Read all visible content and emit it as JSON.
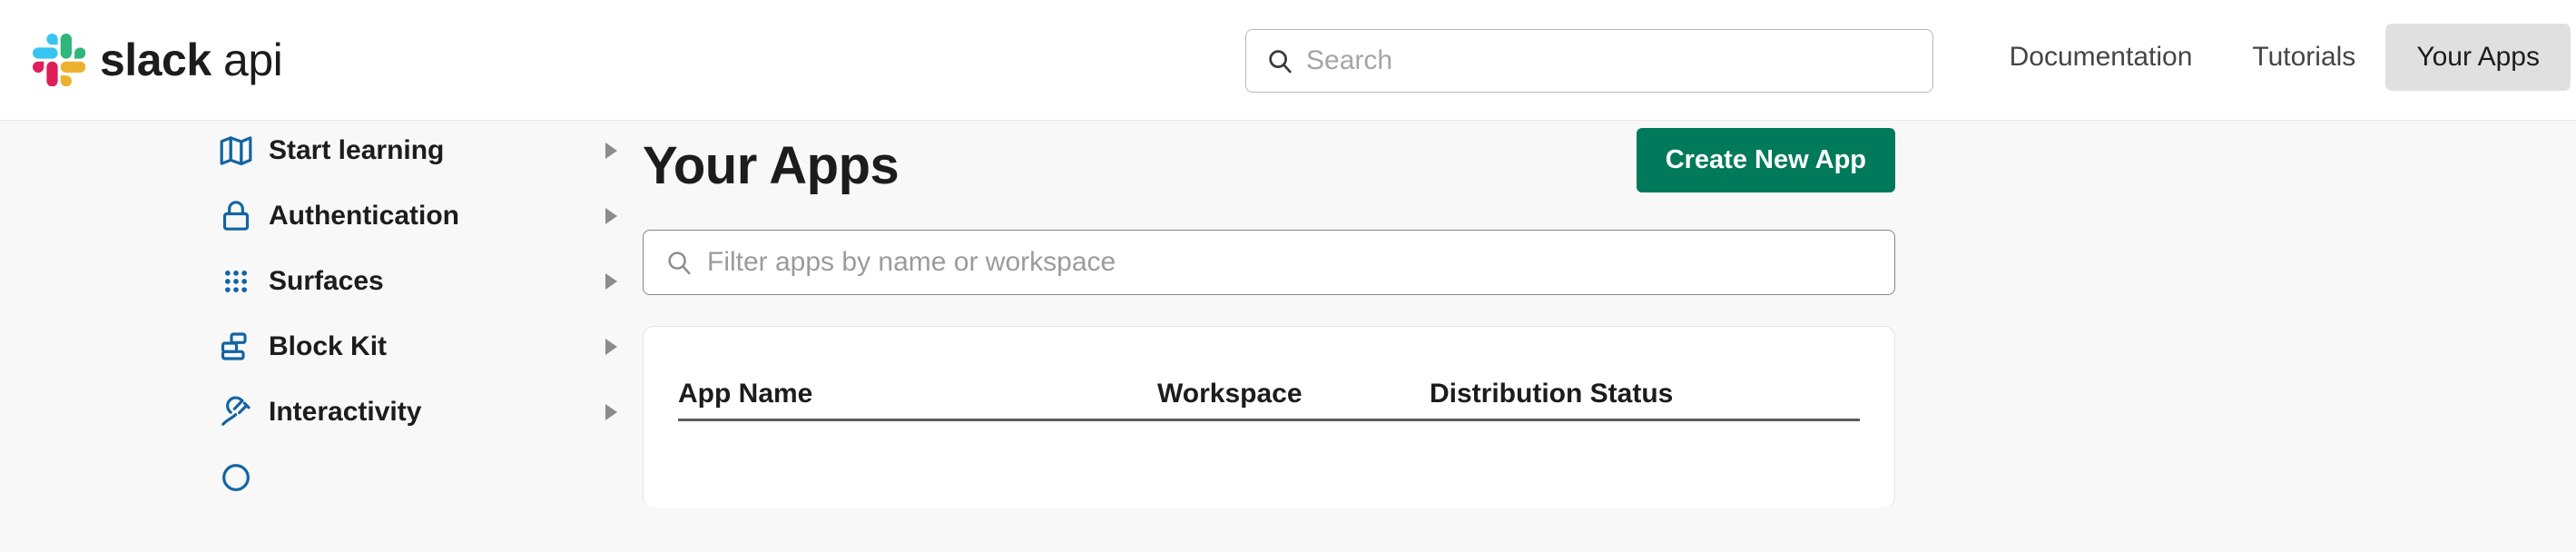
{
  "brand": {
    "logo_icon": "slack-hashtag-logo",
    "name_bold": "slack",
    "name_light": "api",
    "colors": {
      "cyan": "#36C5F0",
      "green": "#2EB67D",
      "crimson": "#E01E5A",
      "yellow": "#ECB22E"
    }
  },
  "header": {
    "search": {
      "icon": "search-icon",
      "placeholder": "Search",
      "value": ""
    },
    "nav": [
      {
        "label": "Documentation",
        "active": false
      },
      {
        "label": "Tutorials",
        "active": false
      },
      {
        "label": "Your Apps",
        "active": true
      }
    ]
  },
  "sidebar": {
    "items": [
      {
        "label": "Start learning",
        "icon": "map-icon",
        "expanded": false
      },
      {
        "label": "Authentication",
        "icon": "lock-icon",
        "expanded": false
      },
      {
        "label": "Surfaces",
        "icon": "grid-dots-icon",
        "expanded": false
      },
      {
        "label": "Block Kit",
        "icon": "blocks-icon",
        "expanded": false
      },
      {
        "label": "Interactivity",
        "icon": "plug-icon",
        "expanded": false
      }
    ],
    "icon_color": "#1264A3",
    "chevron_icon": "chevron-right-icon"
  },
  "main": {
    "title": "Your Apps",
    "create_button": {
      "label": "Create New App",
      "color": "#007a5a"
    },
    "filter": {
      "icon": "search-icon",
      "placeholder": "Filter apps by name or workspace",
      "value": ""
    },
    "table": {
      "columns": [
        "App Name",
        "Workspace",
        "Distribution Status"
      ],
      "rows": []
    }
  }
}
